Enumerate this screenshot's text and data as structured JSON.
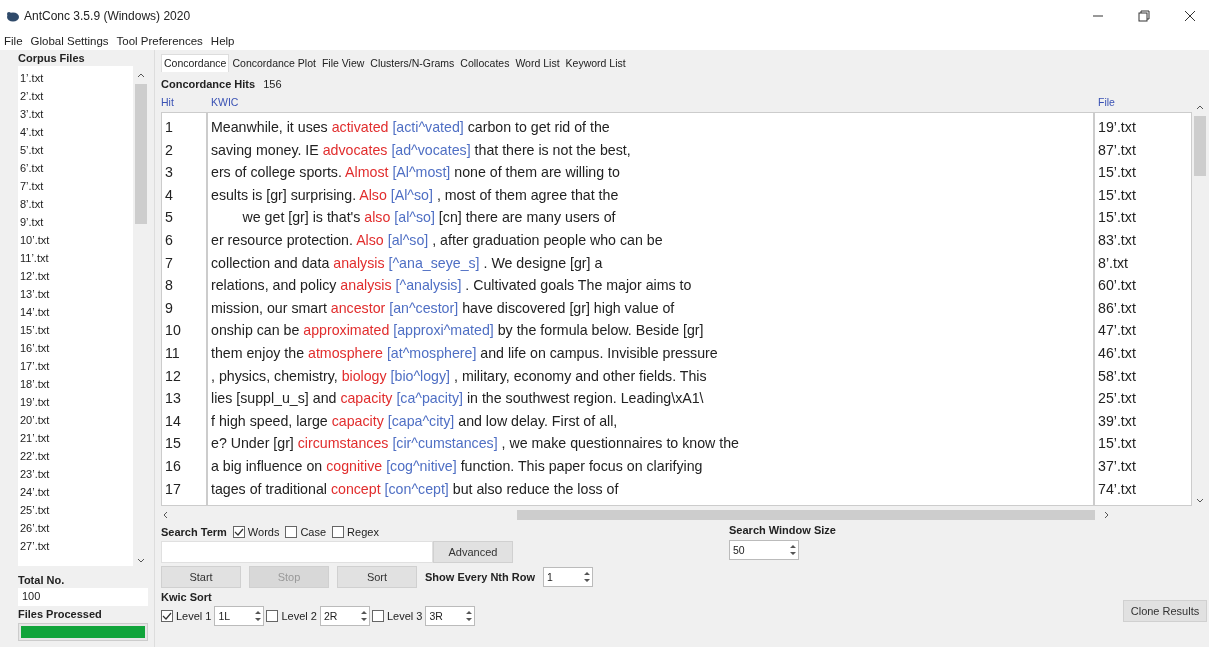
{
  "window": {
    "title": "AntConc 3.5.9 (Windows) 2020"
  },
  "menu": [
    "File",
    "Global Settings",
    "Tool Preferences",
    "Help"
  ],
  "corpus_files": {
    "title": "Corpus Files",
    "files": [
      "1’.txt",
      "2’.txt",
      "3’.txt",
      "4’.txt",
      "5’.txt",
      "6’.txt",
      "7’.txt",
      "8’.txt",
      "9’.txt",
      "10’.txt",
      "11’.txt",
      "12’.txt",
      "13’.txt",
      "14’.txt",
      "15’.txt",
      "16’.txt",
      "17’.txt",
      "18’.txt",
      "19’.txt",
      "20’.txt",
      "21’.txt",
      "22’.txt",
      "23’.txt",
      "24’.txt",
      "25’.txt",
      "26’.txt",
      "27’.txt"
    ],
    "total_label": "Total No.",
    "total_value": "100",
    "processed_label": "Files Processed",
    "level": 1
  },
  "tabs": [
    {
      "label": "Concordance",
      "selected": true
    },
    {
      "label": "Concordance Plot",
      "selected": false
    },
    {
      "label": "File View",
      "selected": false
    },
    {
      "label": "Clusters/N-Grams",
      "selected": false
    },
    {
      "label": "Collocates",
      "selected": false
    },
    {
      "label": "Word List",
      "selected": false
    },
    {
      "label": "Keyword List",
      "selected": false
    }
  ],
  "concordance": {
    "hits_label": "Concordance Hits",
    "hits_value": "156",
    "columns": [
      "Hit",
      "KWIC",
      "File"
    ],
    "rows": [
      {
        "hit": "1",
        "left": "Meanwhile, it uses",
        "keyword": "activated",
        "tag": "[acti^vated]",
        "right": "carbon to get rid of the",
        "file": "19’.txt"
      },
      {
        "hit": "2",
        "left": "saving money. IE",
        "keyword": "advocates",
        "tag": "[ad^vocates]",
        "right": "that there is not the best,",
        "file": "87’.txt"
      },
      {
        "hit": "3",
        "left": "ers of college sports.",
        "keyword": "Almost",
        "tag": "[Al^most]",
        "right": "none of them are willing to",
        "file": "15’.txt"
      },
      {
        "hit": "4",
        "left": "esults is [gr] surprising.",
        "keyword": "Also",
        "tag": "[Al^so]",
        "right": ", most of them agree that the",
        "file": "15’.txt"
      },
      {
        "hit": "5",
        "left": "        we get [gr] is that's",
        "keyword": "also",
        "tag": "[al^so]",
        "right": "[cn] there are many users of",
        "file": "15’.txt"
      },
      {
        "hit": "6",
        "left": "er resource protection.",
        "keyword": "Also",
        "tag": "[al^so]",
        "right": ", after graduation people who can be",
        "file": "83’.txt"
      },
      {
        "hit": "7",
        "left": "collection and data",
        "keyword": "analysis",
        "tag": "[^ana_seye_s]",
        "right": ". We designe [gr] a",
        "file": "8’.txt"
      },
      {
        "hit": "8",
        "left": "relations, and policy",
        "keyword": "analysis",
        "tag": "[^analysis]",
        "right": ". Cultivated goals The major aims to",
        "file": "60’.txt"
      },
      {
        "hit": "9",
        "left": "mission, our smart",
        "keyword": "ancestor",
        "tag": "[an^cestor]",
        "right": "have discovered [gr] high value of",
        "file": "86’.txt"
      },
      {
        "hit": "10",
        "left": "onship can be",
        "keyword": "approximated",
        "tag": "[approxi^mated]",
        "right": "by the formula below. Beside [gr]",
        "file": "47’.txt"
      },
      {
        "hit": "11",
        "left": "them enjoy the",
        "keyword": "atmosphere",
        "tag": "[at^mosphere]",
        "right": "and life on campus. Invisible pressure",
        "file": "46’.txt"
      },
      {
        "hit": "12",
        "left": ", physics, chemistry,",
        "keyword": "biology",
        "tag": "[bio^logy]",
        "right": ", military, economy and other fields. This",
        "file": "58’.txt"
      },
      {
        "hit": "13",
        "left": "lies [suppl_u_s] and",
        "keyword": "capacity",
        "tag": "[ca^pacity]",
        "right": "in the southwest region. Leading\\xA1\\",
        "file": "25’.txt"
      },
      {
        "hit": "14",
        "left": "f high speed, large",
        "keyword": "capacity",
        "tag": "[capa^city]",
        "right": "and low delay. First of all,",
        "file": "39’.txt"
      },
      {
        "hit": "15",
        "left": "e? Under [gr]",
        "keyword": "circumstances",
        "tag": "[cir^cumstances]",
        "right": ", we make questionnaires to know the",
        "file": "15’.txt"
      },
      {
        "hit": "16",
        "left": "a big influence on",
        "keyword": "cognitive",
        "tag": "[cog^nitive]",
        "right": "function. This paper focus on clarifying",
        "file": "37’.txt"
      },
      {
        "hit": "17",
        "left": "tages of traditional",
        "keyword": "concept",
        "tag": "[con^cept]",
        "right": "but also reduce the loss of",
        "file": "74’.txt"
      }
    ]
  },
  "search": {
    "label": "Search Term",
    "options": [
      {
        "label": "Words",
        "checked": true
      },
      {
        "label": "Case",
        "checked": false
      },
      {
        "label": "Regex",
        "checked": false
      }
    ],
    "advanced_button": "Advanced",
    "window_size_label": "Search Window Size",
    "window_size_value": "50"
  },
  "buttons": [
    {
      "label": "Start",
      "disabled": false
    },
    {
      "label": "Stop",
      "disabled": true
    },
    {
      "label": "Sort",
      "disabled": false
    }
  ],
  "nth_row": {
    "label": "Show Every Nth Row",
    "value": "1"
  },
  "kwic_sort": {
    "label": "Kwic Sort",
    "levels": [
      {
        "label": "Level 1",
        "checked": true,
        "value": "1L"
      },
      {
        "label": "Level 2",
        "checked": false,
        "value": "2R"
      },
      {
        "label": "Level 3",
        "checked": false,
        "value": "3R"
      }
    ]
  },
  "clone_button": "Clone Results"
}
